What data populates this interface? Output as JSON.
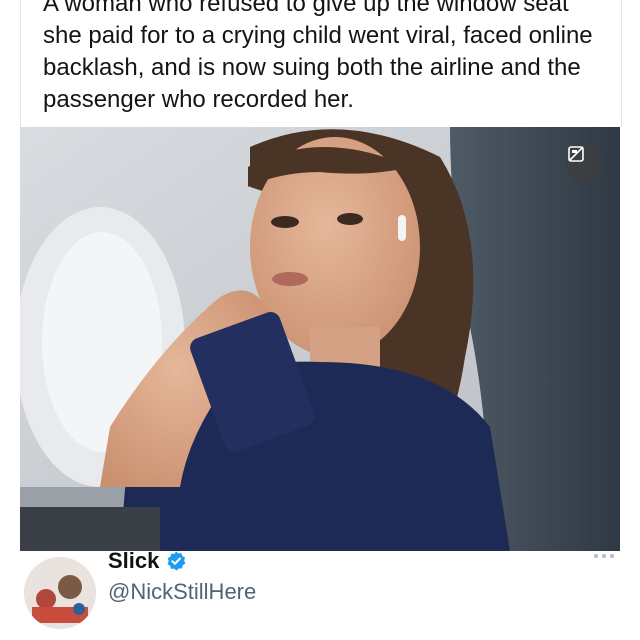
{
  "post": {
    "text": "A woman who refused to give up the window seat she paid for to a crying child went viral, faced online backlash, and is now suing both the airline and the passenger who recorded her."
  },
  "media": {
    "badge_icon": "media-crop-icon"
  },
  "author": {
    "display_name": "Slick",
    "handle": "@NickStillHere",
    "verified": true,
    "verified_color": "#1d9bf0"
  },
  "colors": {
    "text": "#0f1419",
    "secondary_text": "#536471",
    "accent": "#1d9bf0"
  }
}
